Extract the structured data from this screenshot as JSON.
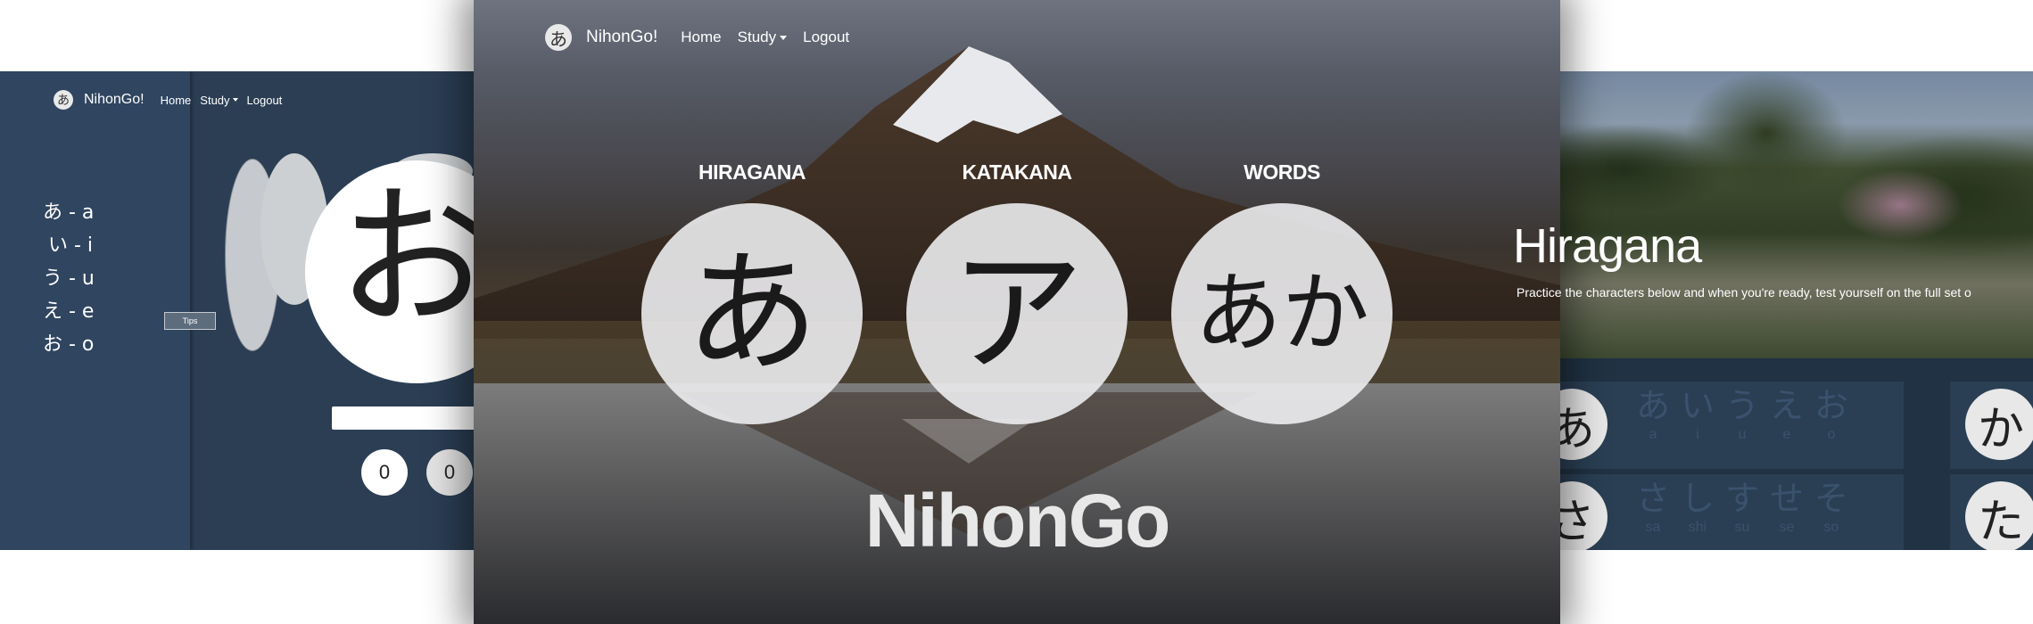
{
  "left": {
    "brand": "NihonGo!",
    "nav": {
      "home": "Home",
      "study": "Study",
      "logout": "Logout"
    },
    "kana_list": [
      "あ - a",
      "い - i",
      "う - u",
      "え - e",
      "お - o"
    ],
    "tips": "Tips",
    "card_char": "お",
    "scores": [
      "0",
      "0"
    ]
  },
  "center": {
    "logo_char": "あ",
    "brand": "NihonGo!",
    "nav": {
      "home": "Home",
      "study": "Study",
      "logout": "Logout"
    },
    "sections": [
      {
        "label": "HIRAGANA",
        "char": "あ"
      },
      {
        "label": "KATAKANA",
        "char": "ア"
      },
      {
        "label": "WORDS",
        "char": "あか"
      }
    ],
    "title": "NihonGo"
  },
  "right": {
    "title": "Hiragana",
    "subtitle": "Practice the characters below and when you're ready, test yourself on the full set o",
    "rows": [
      {
        "big": "あ",
        "kana": [
          "あ",
          "い",
          "う",
          "え",
          "お"
        ],
        "romaji": [
          "a",
          "i",
          "u",
          "e",
          "o"
        ]
      },
      {
        "big": "さ",
        "kana": [
          "さ",
          "し",
          "す",
          "せ",
          "そ"
        ],
        "romaji": [
          "sa",
          "shi",
          "su",
          "se",
          "so"
        ]
      }
    ],
    "side": [
      "か",
      "た"
    ]
  }
}
